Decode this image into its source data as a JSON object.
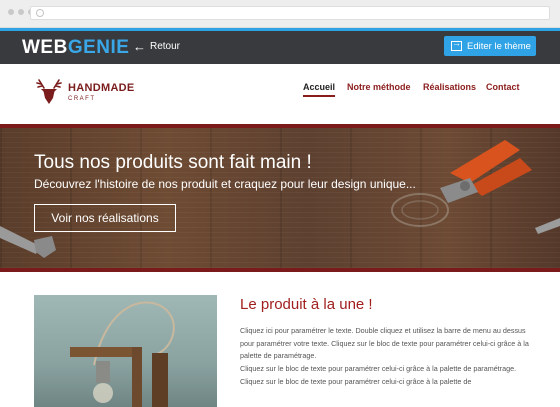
{
  "editor": {
    "logo_part1": "WEB",
    "logo_part2": "GENIE",
    "back_label": "Retour",
    "theme_button_label": "Editer le thème"
  },
  "site": {
    "brand_main": "HANDMADE",
    "brand_sub": "CRAFT",
    "nav": [
      {
        "label": "Accueil",
        "active": true
      },
      {
        "label": "Notre méthode",
        "active": false
      },
      {
        "label": "Réalisations",
        "active": false
      },
      {
        "label": "Contact",
        "active": false
      }
    ]
  },
  "hero": {
    "title": "Tous nos produits sont fait main !",
    "subtitle": "Découvrez l'histoire de nos produit et craquez pour leur design unique...",
    "button_label": "Voir nos réalisations"
  },
  "featured": {
    "title": "Le produit à la une !",
    "paragraphs": [
      "Cliquez ici pour paramétrer le texte. Double cliquez et utilisez la barre de menu au dessus pour paramétrer votre texte. Cliquez sur le bloc de texte pour paramétrer celui-ci grâce à la palette de paramétrage.",
      "Cliquez sur le bloc de texte pour paramétrer celui-ci grâce à la palette de paramétrage.",
      "Cliquez sur le bloc de texte pour paramétrer celui-ci grâce à la palette de"
    ]
  },
  "colors": {
    "accent_blue": "#2fa3e6",
    "brand_red": "#8b1c1c",
    "toolbar_dark": "#383a3d"
  }
}
